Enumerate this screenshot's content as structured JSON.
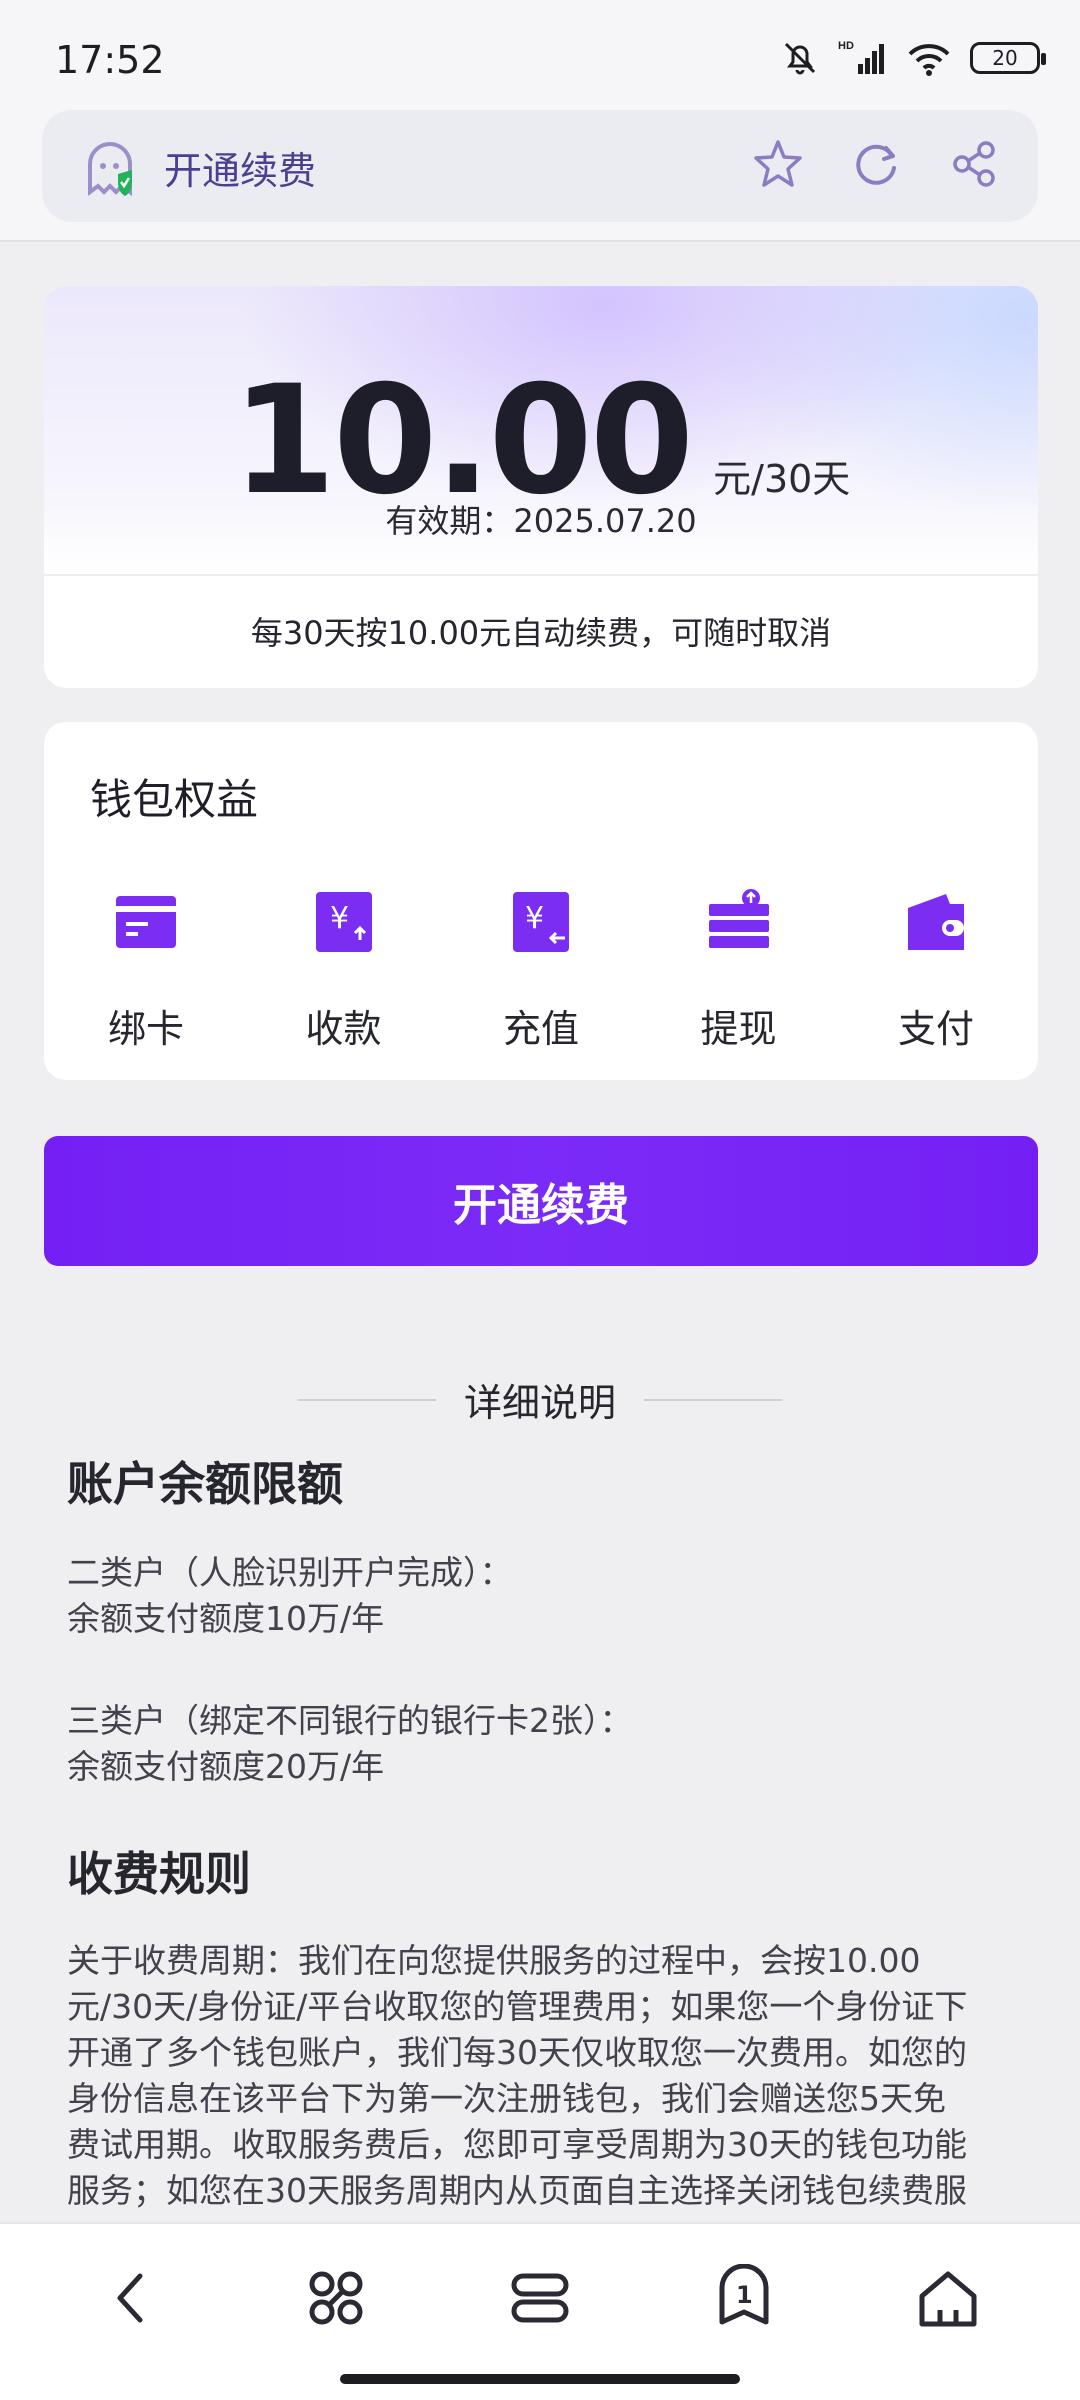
{
  "status_bar": {
    "time": "17:52",
    "battery": "20",
    "network": "HD"
  },
  "browser": {
    "site_title": "开通续费",
    "icons": [
      "ghost-shield-icon",
      "star-icon",
      "refresh-icon",
      "share-icon"
    ]
  },
  "price_card": {
    "amount": "10.00",
    "unit": "元/30天",
    "validity_label": "有效期：",
    "validity_date": "2025.07.20",
    "renew_note": "每30天按10.00元自动续费，可随时取消"
  },
  "benefits": {
    "title": "钱包权益",
    "items": [
      {
        "label": "绑卡",
        "icon": "bind-card-icon"
      },
      {
        "label": "收款",
        "icon": "receive-money-icon"
      },
      {
        "label": "充值",
        "icon": "recharge-icon"
      },
      {
        "label": "提现",
        "icon": "withdraw-icon"
      },
      {
        "label": "支付",
        "icon": "wallet-pay-icon"
      }
    ]
  },
  "main_button": {
    "label": "开通续费"
  },
  "details": {
    "title": "详细说明",
    "balance_limit": {
      "title": "账户余额限额",
      "class2_line1": "二类户（人脸识别开户完成）：",
      "class2_line2": "余额支付额度10万/年",
      "class3_line1": "三类户（绑定不同银行的银行卡2张）：",
      "class3_line2": "余额支付额度20万/年"
    },
    "fee_rules": {
      "title": "收费规则",
      "lines": [
        "关于收费周期：我们在向您提供服务的过程中，会按10.00",
        "元/30天/身份证/平台收取您的管理费用；如果您一个身份证下",
        "开通了多个钱包账户，我们每30天仅收取您一次费用。如您的",
        "身份信息在该平台下为第一次注册钱包，我们会赠送您5天免",
        "费试用期。收取服务费后，您即可享受周期为30天的钱包功能",
        "服务；如您在30天服务周期内从页面自主选择关闭钱包续费服"
      ]
    }
  },
  "bottom_nav": {
    "items": [
      "back-icon",
      "apps-icon",
      "tabs-icon",
      "tab-count-icon",
      "home-icon"
    ],
    "tab_count": "1"
  },
  "colors": {
    "accent": "#7420F5",
    "icon_purple": "#7B2EF2",
    "brand_text": "#4C3F91"
  }
}
